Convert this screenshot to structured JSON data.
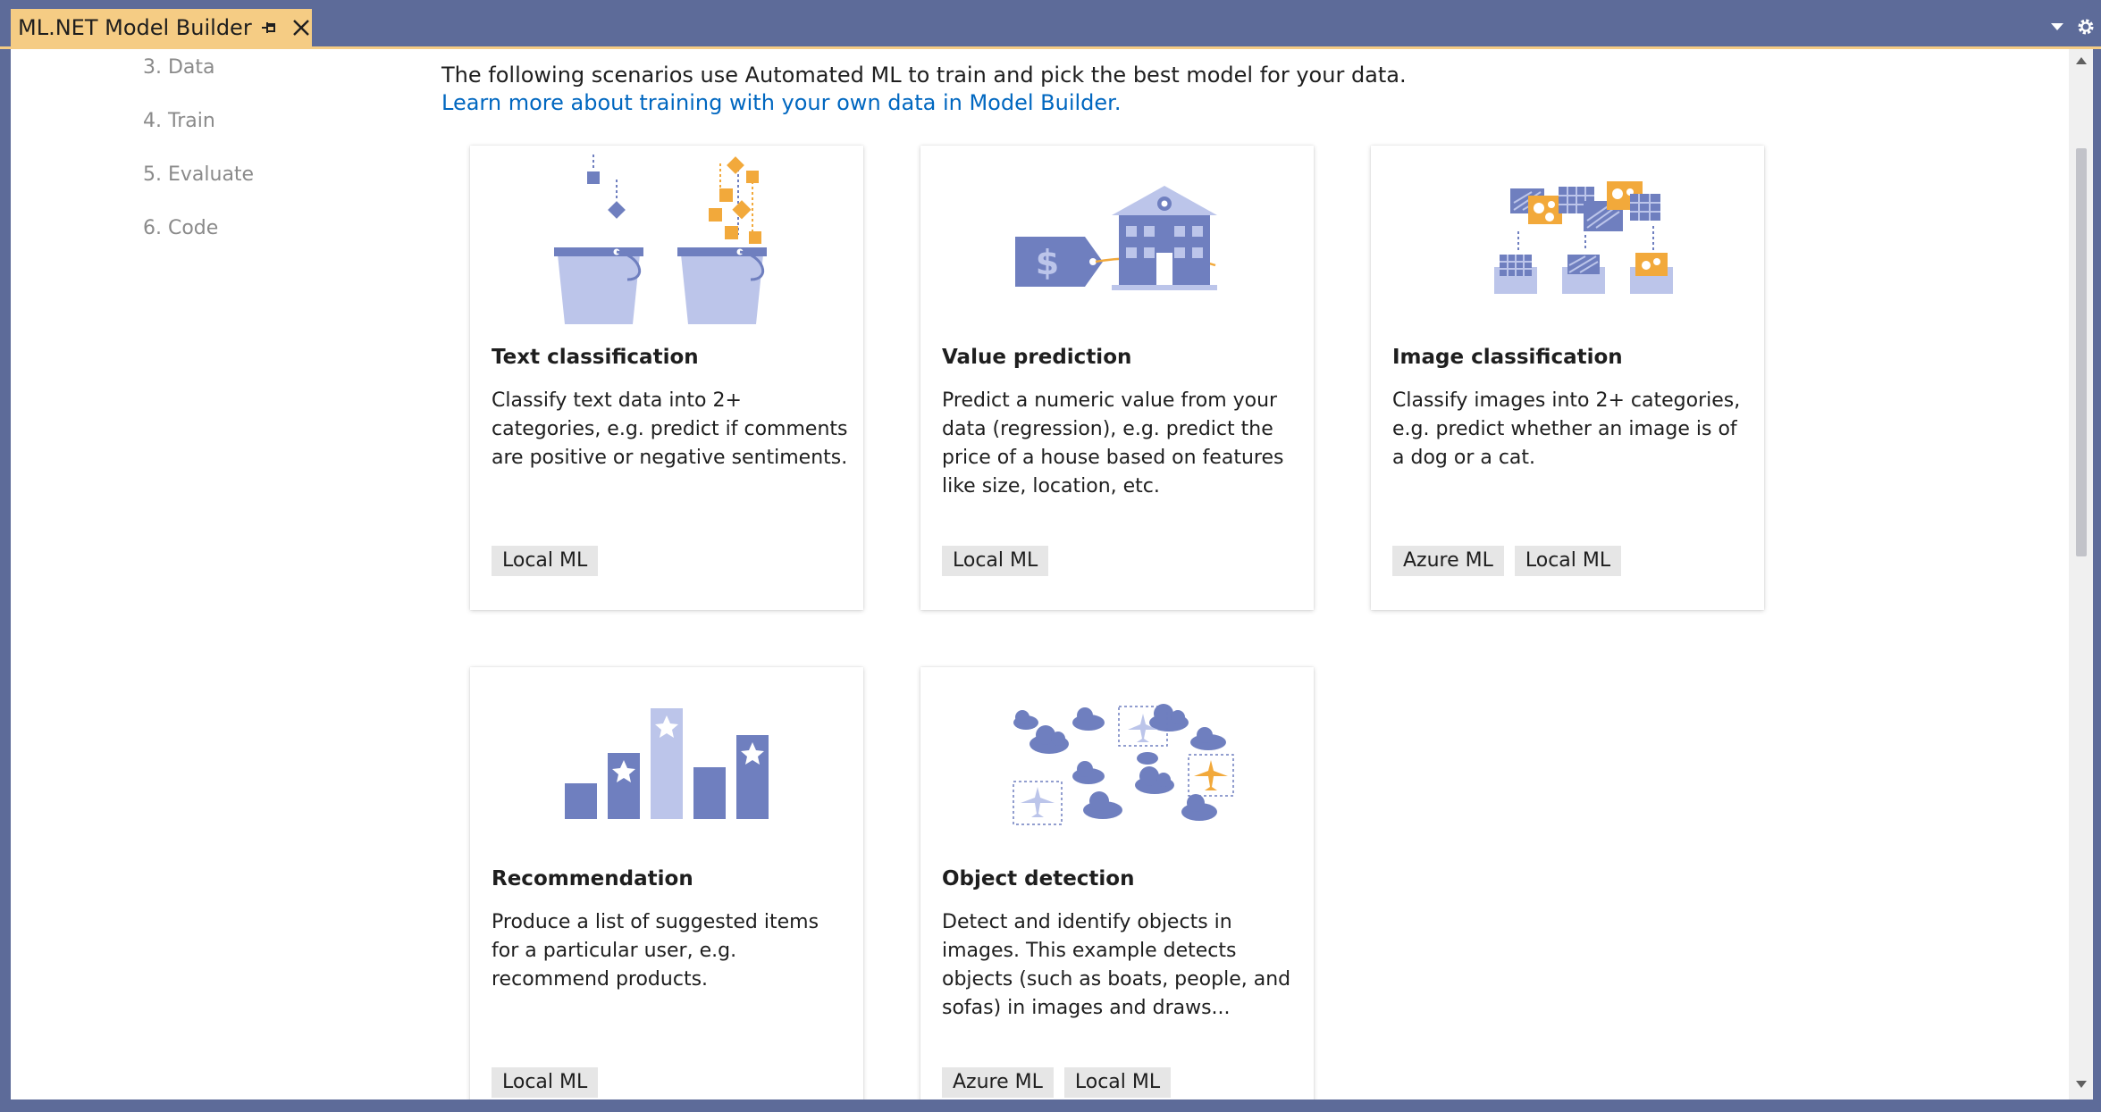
{
  "window": {
    "tab_title": "ML.NET Model Builder"
  },
  "steps": [
    {
      "label": "3. Data"
    },
    {
      "label": "4. Train"
    },
    {
      "label": "5. Evaluate"
    },
    {
      "label": "6. Code"
    }
  ],
  "intro": {
    "text": "The following scenarios use Automated ML to train and pick the best model for your data.",
    "link": "Learn more about training with your own data in Model Builder."
  },
  "cards": [
    {
      "title": "Text classification",
      "description": "Classify text data into 2+ categories, e.g. predict if comments are positive or negative sentiments.",
      "badges": [
        "Local ML"
      ]
    },
    {
      "title": "Value prediction",
      "description": "Predict a numeric value from your data (regression), e.g. predict the price of a house based on features like size, location, etc.",
      "badges": [
        "Local ML"
      ]
    },
    {
      "title": "Image classification",
      "description": "Classify images into 2+ categories, e.g. predict whether an image is of a dog or a cat.",
      "badges": [
        "Azure ML",
        "Local ML"
      ]
    },
    {
      "title": "Recommendation",
      "description": "Produce a list of suggested items for a particular user, e.g. recommend products.",
      "badges": [
        "Local ML"
      ]
    },
    {
      "title": "Object detection",
      "description": "Detect and identify objects in images. This example detects objects (such as boats, people, and sofas) in images and draws...",
      "badges": [
        "Azure ML",
        "Local ML"
      ]
    }
  ],
  "icons": {
    "tab_pin": "pin-icon",
    "tab_close": "close-icon",
    "window_menu": "chevron-down-icon",
    "settings": "gear-icon",
    "card_illustrations": [
      "buckets-illustration",
      "house-price-tag-illustration",
      "image-grid-illustration",
      "bar-chart-stars-illustration",
      "clouds-airplanes-illustration"
    ]
  },
  "colors": {
    "chrome": "#5d6b99",
    "active_tab": "#f5cc84",
    "link": "#0067c0",
    "illustration_primary": "#6f7fbf",
    "illustration_light": "#bcc5ea",
    "illustration_accent": "#f2a93b"
  }
}
